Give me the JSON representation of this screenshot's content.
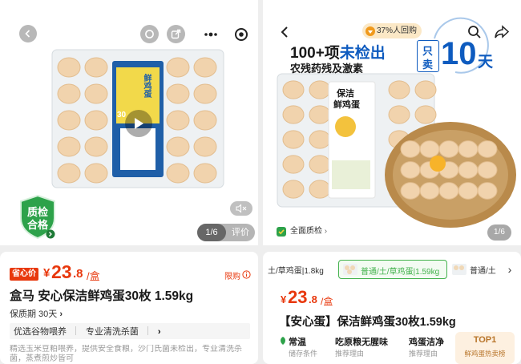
{
  "left": {
    "media": {
      "play_icon": "play-icon",
      "quality_badge": [
        "质检",
        "合格"
      ],
      "pager": "1/6",
      "review_label": "评价",
      "box_label_small": "鲜鸡蛋",
      "box_label_side": "30"
    },
    "price": {
      "tag": "省心价",
      "currency": "¥",
      "integer": "23",
      "decimal": ".8",
      "unit": "/盒",
      "limit_label": "限购"
    },
    "title": "盒马 安心保洁鲜鸡蛋30枚 1.59kg",
    "shelf_life": "保质期 30天",
    "features": [
      "优选谷物喂养",
      "专业清洗杀菌"
    ],
    "description": "精选玉米豆粕喂养，提供安全食粮，沙门氏菌未检出，专业清洗杀菌，蒸煮煎炒皆可"
  },
  "right": {
    "media": {
      "group_buy": "37%人回购",
      "headline_a": "100+项",
      "headline_b": "未检出",
      "subline": "农残药残及激素",
      "only_sell_a": "只",
      "only_sell_b": "卖",
      "days_number": "10",
      "days_unit": "天",
      "box_title": [
        "保洁",
        "鲜鸡蛋"
      ],
      "quality_link": "全面质检",
      "pager": "1/6"
    },
    "variants": [
      {
        "label": "土/草鸡蛋|1.8kg"
      },
      {
        "label": "普通/土/草鸡蛋|1.59kg"
      },
      {
        "label": "普通/土"
      }
    ],
    "price": {
      "currency": "¥",
      "integer": "23",
      "decimal": ".8",
      "unit": "/盒"
    },
    "title": "【安心蛋】保洁鲜鸡蛋30枚1.59kg",
    "attributes": [
      {
        "title": "常温",
        "sub": "储存条件"
      },
      {
        "title": "吃原粮无腥味",
        "sub": "推荐理由"
      },
      {
        "title": "鸡蛋洁净",
        "sub": "推荐理由"
      }
    ],
    "rank": {
      "label": "TOP1",
      "sub": "鲜鸡蛋热卖榜"
    }
  },
  "colors": {
    "price_red": "#e8380d",
    "badge_green": "#2da24a",
    "variant_green": "#43b24d",
    "headline_blue": "#0e5bbf"
  }
}
